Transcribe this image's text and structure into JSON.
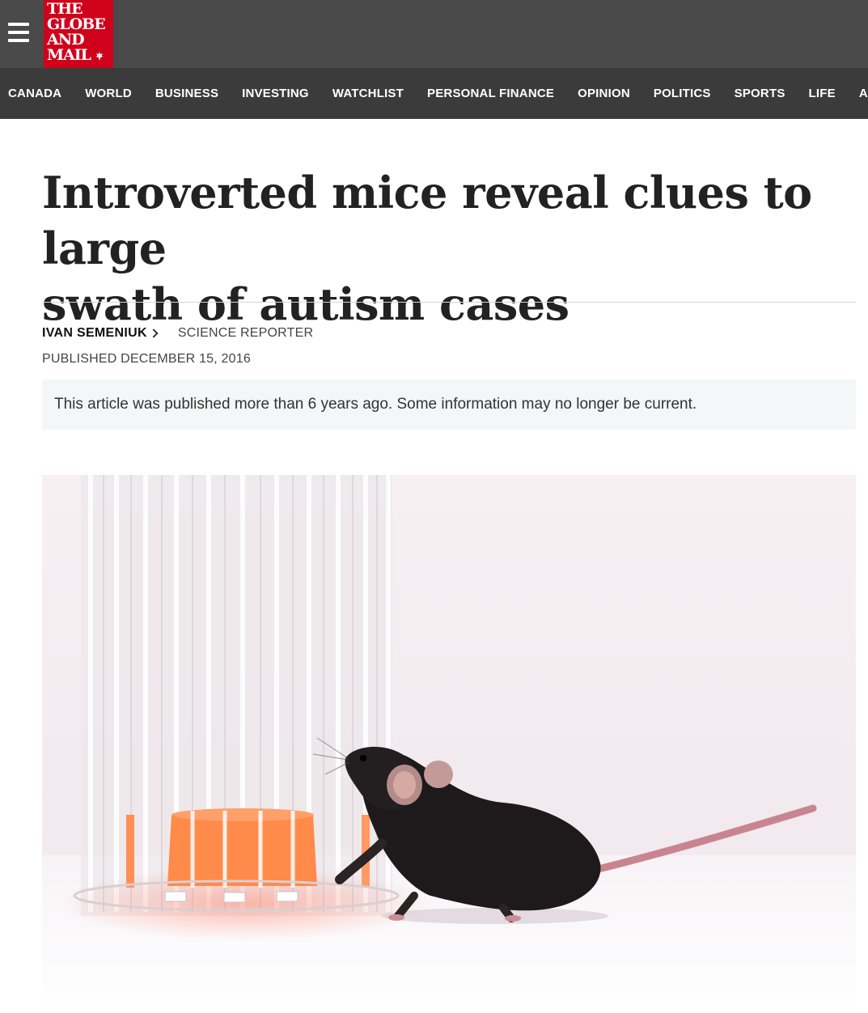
{
  "header": {
    "logo_lines": [
      "THE",
      "GLOBE",
      "AND",
      "MAIL"
    ],
    "nav": [
      "CANADA",
      "WORLD",
      "BUSINESS",
      "INVESTING",
      "WATCHLIST",
      "PERSONAL FINANCE",
      "OPINION",
      "POLITICS",
      "SPORTS",
      "LIFE",
      "ARTS"
    ]
  },
  "article": {
    "headline_line1": "Introverted mice reveal clues to large",
    "headline_line2": "swath of autism cases",
    "author": "IVAN SEMENIUK",
    "role": "SCIENCE REPORTER",
    "published": "PUBLISHED DECEMBER 15, 2016",
    "notice": "This article was published more than 6 years ago. Some information may no longer be current."
  },
  "icons": {
    "menu": "hamburger-menu-icon",
    "author_link": "chevron-right-icon",
    "logo_mark": "maple-leaf-icon"
  },
  "colors": {
    "brand_red": "#d0021b",
    "topbar": "#4a4a4a",
    "navbar": "#3b3b3b",
    "notice_bg": "#f3f7f7"
  }
}
